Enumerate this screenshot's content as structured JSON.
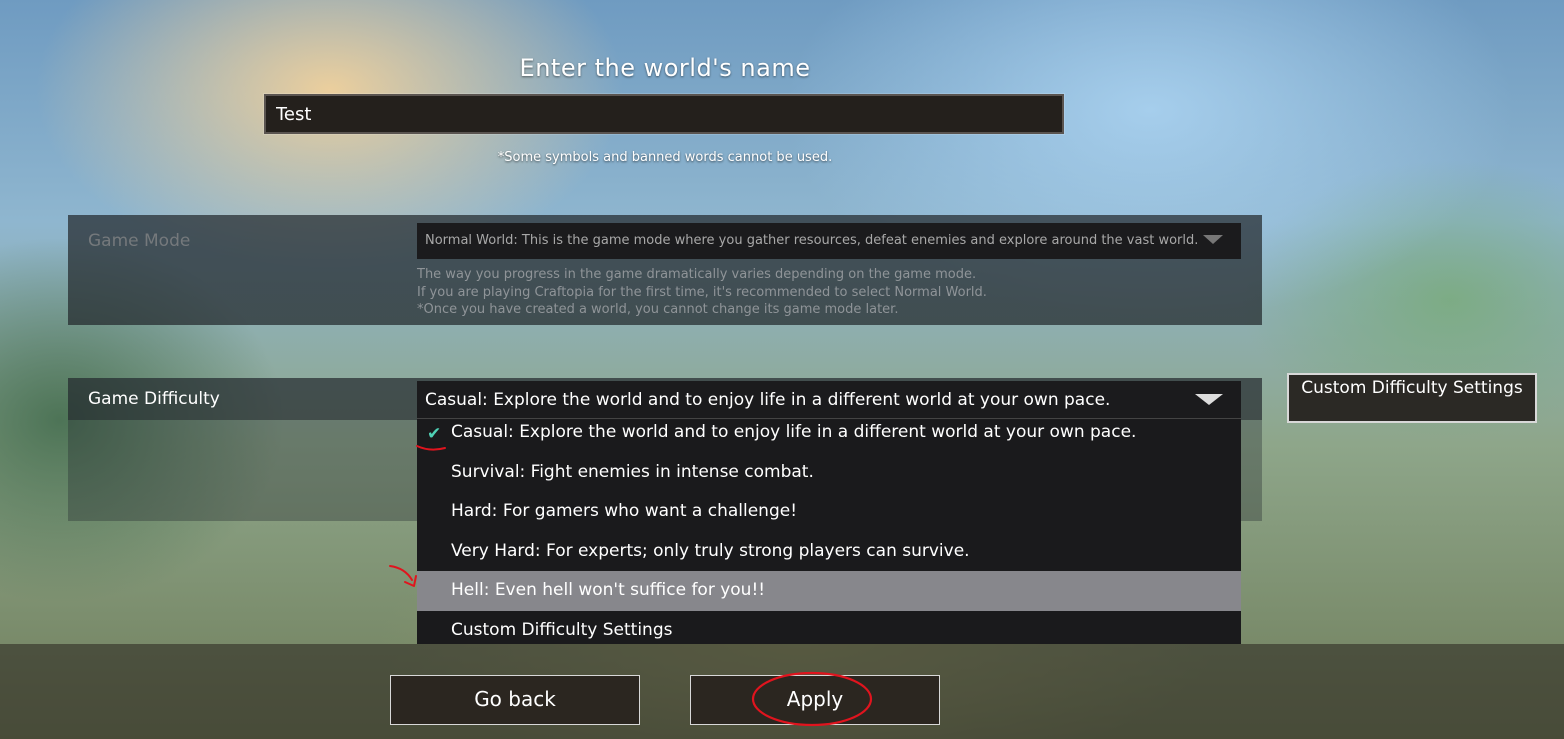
{
  "world": {
    "title": "Enter the world's name",
    "name_value": "Test",
    "note": "*Some symbols and banned words cannot be used."
  },
  "game_mode": {
    "label": "Game Mode",
    "selected": "Normal World: This is the game mode where you gather resources, defeat enemies and explore around the vast world.",
    "description": [
      "The way you progress in the game dramatically varies depending on the game mode.",
      "If you are playing Craftopia for the first time, it's recommended to select Normal World.",
      "*Once you have created a world, you cannot change its game mode later."
    ]
  },
  "game_difficulty": {
    "label": "Game Difficulty",
    "selected": "Casual: Explore the world and to enjoy life in a different world at your own pace.",
    "options": [
      "Casual: Explore the world and to enjoy life in a different world at your own pace.",
      "Survival: Fight enemies in intense combat.",
      "Hard: For gamers who want a challenge!",
      "Very Hard: For experts; only truly strong players can survive.",
      "Hell: Even hell won't suffice for you!!",
      "Custom Difficulty Settings"
    ],
    "checked_option": "Casual: Explore the world and to enjoy life in a different world at your own pace.",
    "highlighted_option": "Hell: Even hell won't suffice for you!!",
    "custom_button": "Custom Difficulty Settings"
  },
  "buttons": {
    "back": "Go back",
    "apply": "Apply"
  },
  "colors": {
    "check": "#4fd1b5",
    "highlight": "#87878c",
    "annotation": "#e0141e"
  },
  "icons": {
    "mode_dropdown": "chevron-down-icon",
    "difficulty_dropdown": "chevron-down-icon",
    "selected_option": "checkmark-icon"
  }
}
